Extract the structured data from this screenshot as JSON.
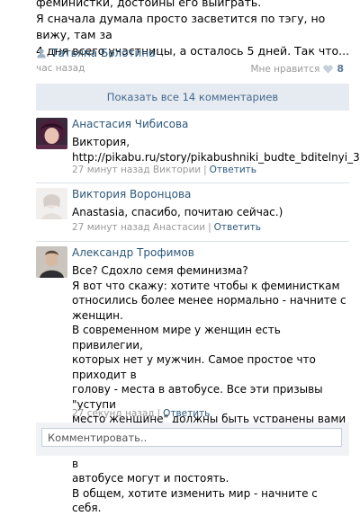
{
  "post": {
    "text": "феминистки, достойны его выиграть.\nЯ сначала думала просто засветится по тэгу, но вижу, там за\n4 дня всего участницы, а осталось 5 дней. Так что...",
    "author_name": "Татьяна Болотина",
    "time": "час назад",
    "like_label": "Мне нравится",
    "like_count": "8",
    "icons": {
      "author": "user-icon",
      "like": "heart-icon"
    }
  },
  "show_all_label": "Показать все 14 комментариев",
  "comments": [
    {
      "name": "Анастасия Чибисова",
      "text": "Виктория,\nhttp://pikabu.ru/story/pikabushniki_budte_bditelnyi_3..",
      "time": "27 минут назад Виктории",
      "reply": "Ответить"
    },
    {
      "name": "Виктория Воронцова",
      "text": "Anastasia, спасибо, почитаю сейчас.)",
      "time": "27 минут назад Анастасии",
      "reply": "Ответить"
    },
    {
      "name": "Александр Трофимов",
      "text": "Все? Сдохло семя феминизма?\nЯ вот что скажу: хотите чтобы к феминисткам\nотносились более менее нормально - начните с женщин.\nВ современном мире у женщин есть привилегии,\nкоторых нет у мужчин. Самое простое что приходит в\nголову - места в автобусе. Все эти призывы \"уступи\nместо женщине\" должны быть устранены вами же, ведь\nвы за \"сильных женщин\", а сильные женщины в\nавтобусе могут и постоять.\nВ общем, хотите изменить мир - начните с себя.",
      "time": "27 секунд назад",
      "reply": "Ответить"
    }
  ],
  "comment_input": {
    "placeholder": "Комментировать.."
  }
}
